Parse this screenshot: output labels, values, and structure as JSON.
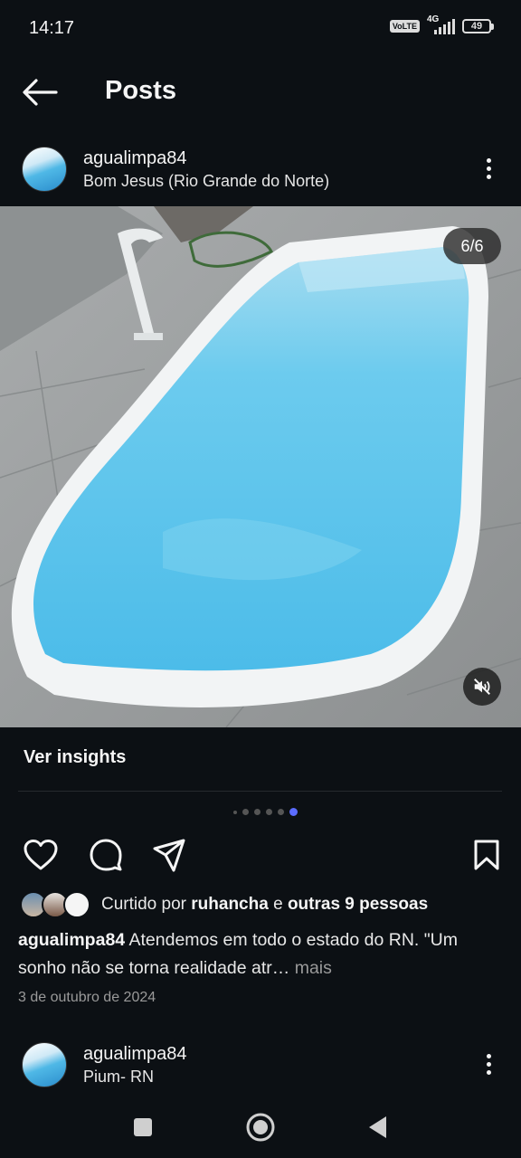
{
  "status_bar": {
    "time": "14:17",
    "volte": "VoLTE",
    "network": "4G",
    "battery": "49"
  },
  "header": {
    "title": "Posts",
    "back_icon": "arrow-left-icon"
  },
  "post": {
    "username": "agualimpa84",
    "location": "Bom Jesus (Rio Grande do Norte)",
    "image_counter": "6/6",
    "insights_label": "Ver insights",
    "carousel": {
      "count": 6,
      "active_index": 5
    },
    "likes": {
      "prefix": "Curtido por ",
      "user": "ruhancha",
      "middle": " e ",
      "others": "outras 9 pessoas"
    },
    "caption": {
      "username": "agualimpa84",
      "text": " Atendemos em todo o estado do RN. \"Um sonho não se torna realidade atr…",
      "more": " mais"
    },
    "date": "3 de outubro de 2024"
  },
  "next_post": {
    "username": "agualimpa84",
    "location": "Pium- RN"
  },
  "colors": {
    "background": "#0c1014",
    "accent_dot": "#5b6cff",
    "pool_water": "#5cc4ec"
  }
}
